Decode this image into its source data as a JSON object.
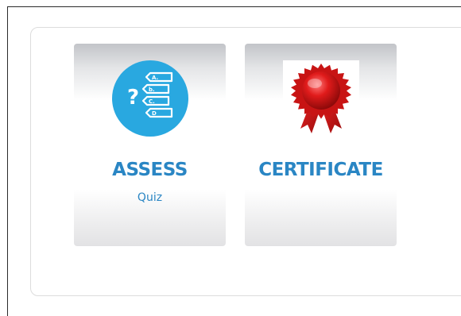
{
  "tiles": [
    {
      "title": "ASSESS",
      "subtitle": "Quiz",
      "icon": "quiz-icon"
    },
    {
      "title": "CERTIFICATE",
      "icon": "award-ribbon-icon"
    }
  ],
  "quiz_icon": {
    "question_mark": "?",
    "options": [
      "A.",
      "b.",
      "C.",
      "D"
    ],
    "accent": "#29a8e0"
  },
  "colors": {
    "title": "#2a86c4",
    "ribbon": "#d81818"
  }
}
